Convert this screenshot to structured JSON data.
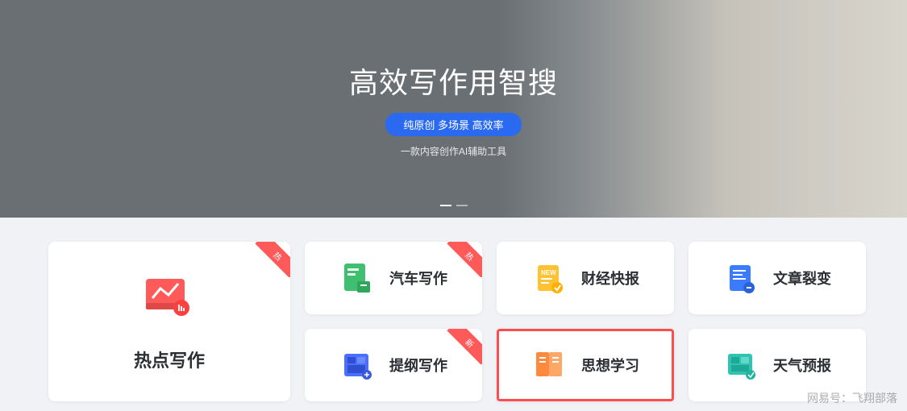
{
  "hero": {
    "title": "高效写作用智搜",
    "pill": "纯原创 多场景 高效率",
    "subtitle": "一款内容创作AI辅助工具"
  },
  "ribbons": {
    "hot": "热",
    "new": "新"
  },
  "cards": {
    "featured": {
      "label": "热点写作",
      "icon": "monitor-red",
      "ribbon": "hot"
    },
    "r1c1": {
      "label": "汽车写作",
      "icon": "book-green",
      "ribbon": "hot"
    },
    "r1c2": {
      "label": "财经快报",
      "icon": "doc-yellow"
    },
    "r1c3": {
      "label": "文章裂变",
      "icon": "doc-blue"
    },
    "r2c1": {
      "label": "提纲写作",
      "icon": "layout-blue",
      "ribbon": "new"
    },
    "r2c2": {
      "label": "思想学习",
      "icon": "book-orange",
      "selected": true
    },
    "r2c3": {
      "label": "天气预报",
      "icon": "panel-teal"
    }
  },
  "watermark": "网易号：飞翔部落",
  "colors": {
    "accent": "#2a6af0",
    "ribbon": "#ff5a5a",
    "select": "#ff4c4c"
  }
}
